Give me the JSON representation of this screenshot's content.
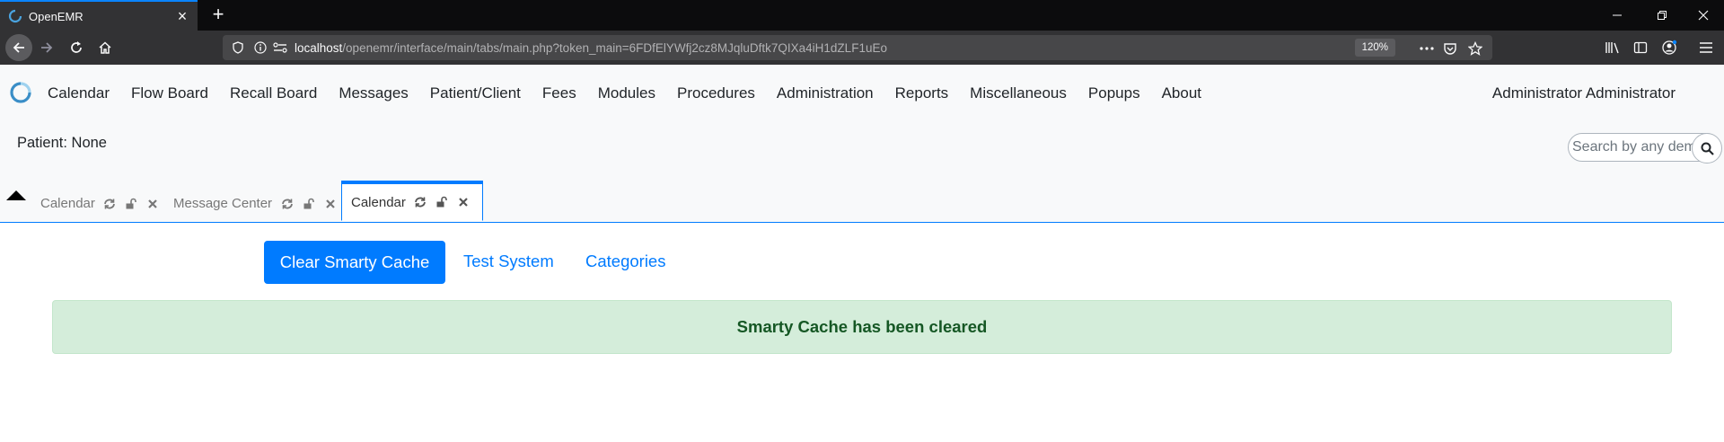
{
  "browser": {
    "tab_title": "OpenEMR",
    "url_host": "localhost",
    "url_rest": "/openemr/interface/main/tabs/main.php?token_main=6FDfElYWfj2cz8MJqluDftk7QIXa4iH1dZLF1uEo",
    "zoom": "120%"
  },
  "menu": {
    "items": [
      "Calendar",
      "Flow Board",
      "Recall Board",
      "Messages",
      "Patient/Client",
      "Fees",
      "Modules",
      "Procedures",
      "Administration",
      "Reports",
      "Miscellaneous",
      "Popups",
      "About"
    ],
    "user": "Administrator Administrator"
  },
  "patient": {
    "label": "Patient: None"
  },
  "search": {
    "placeholder": "Search by any demographics"
  },
  "tabs": [
    {
      "label": "Calendar",
      "active": false
    },
    {
      "label": "Message Center",
      "active": false
    },
    {
      "label": "Calendar",
      "active": true
    }
  ],
  "actions": {
    "clear_cache": "Clear Smarty Cache",
    "test_system": "Test System",
    "categories": "Categories"
  },
  "alert": {
    "message": "Smarty Cache has been cleared"
  },
  "colors": {
    "primary": "#007bff",
    "alert_bg": "#d4edda",
    "alert_text": "#155724"
  }
}
